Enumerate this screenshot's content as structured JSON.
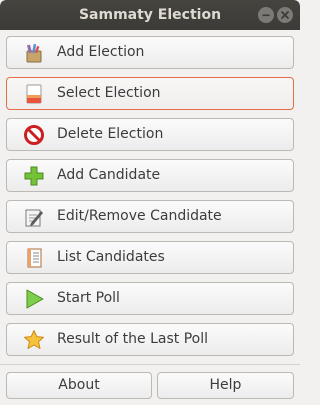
{
  "window": {
    "title": "Sammaty Election"
  },
  "menu": {
    "items": [
      {
        "label": "Add Election",
        "icon": "add-election-icon"
      },
      {
        "label": "Select Election",
        "icon": "select-election-icon",
        "selected": true
      },
      {
        "label": "Delete Election",
        "icon": "delete-icon"
      },
      {
        "label": "Add Candidate",
        "icon": "add-icon"
      },
      {
        "label": "Edit/Remove Candidate",
        "icon": "edit-icon"
      },
      {
        "label": "List Candidates",
        "icon": "list-icon"
      },
      {
        "label": "Start Poll",
        "icon": "play-icon"
      },
      {
        "label": "Result of the Last Poll",
        "icon": "star-icon"
      }
    ]
  },
  "footer": {
    "about_label": "About",
    "help_label": "Help"
  },
  "colors": {
    "titlebar": "#3c3b37",
    "selected_border": "#e46e45",
    "background": "#f2f1f0"
  }
}
